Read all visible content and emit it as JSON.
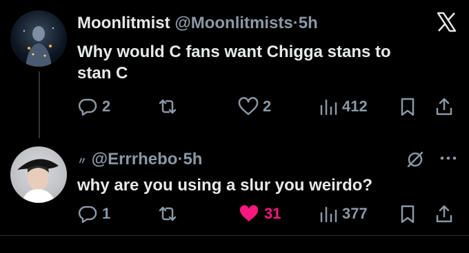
{
  "tweet1": {
    "name": "Moonlitmist",
    "handle": "@Moonlitmists",
    "sep": "·",
    "time": "5h",
    "text_line1": "Why would C fans want Chigga stans to",
    "text_line2": "stan C",
    "actions": {
      "replies": "2",
      "retweets": "",
      "likes": "2",
      "views": "412"
    }
  },
  "tweet2": {
    "prefix": "〃",
    "handle": "@Errrhebo",
    "sep": "·",
    "time": "5h",
    "text": "why are you using a slur you weirdo?",
    "actions": {
      "replies": "1",
      "retweets": "",
      "likes": "31",
      "views": "377"
    }
  },
  "colors": {
    "background": "#000000",
    "text": "#e7e9ea",
    "muted": "#8b98a5",
    "like": "#f91880"
  },
  "icons": [
    "x-logo-icon",
    "reply-icon",
    "retweet-icon",
    "like-icon",
    "views-icon",
    "bookmark-icon",
    "share-icon",
    "mute-icon",
    "more-icon"
  ]
}
